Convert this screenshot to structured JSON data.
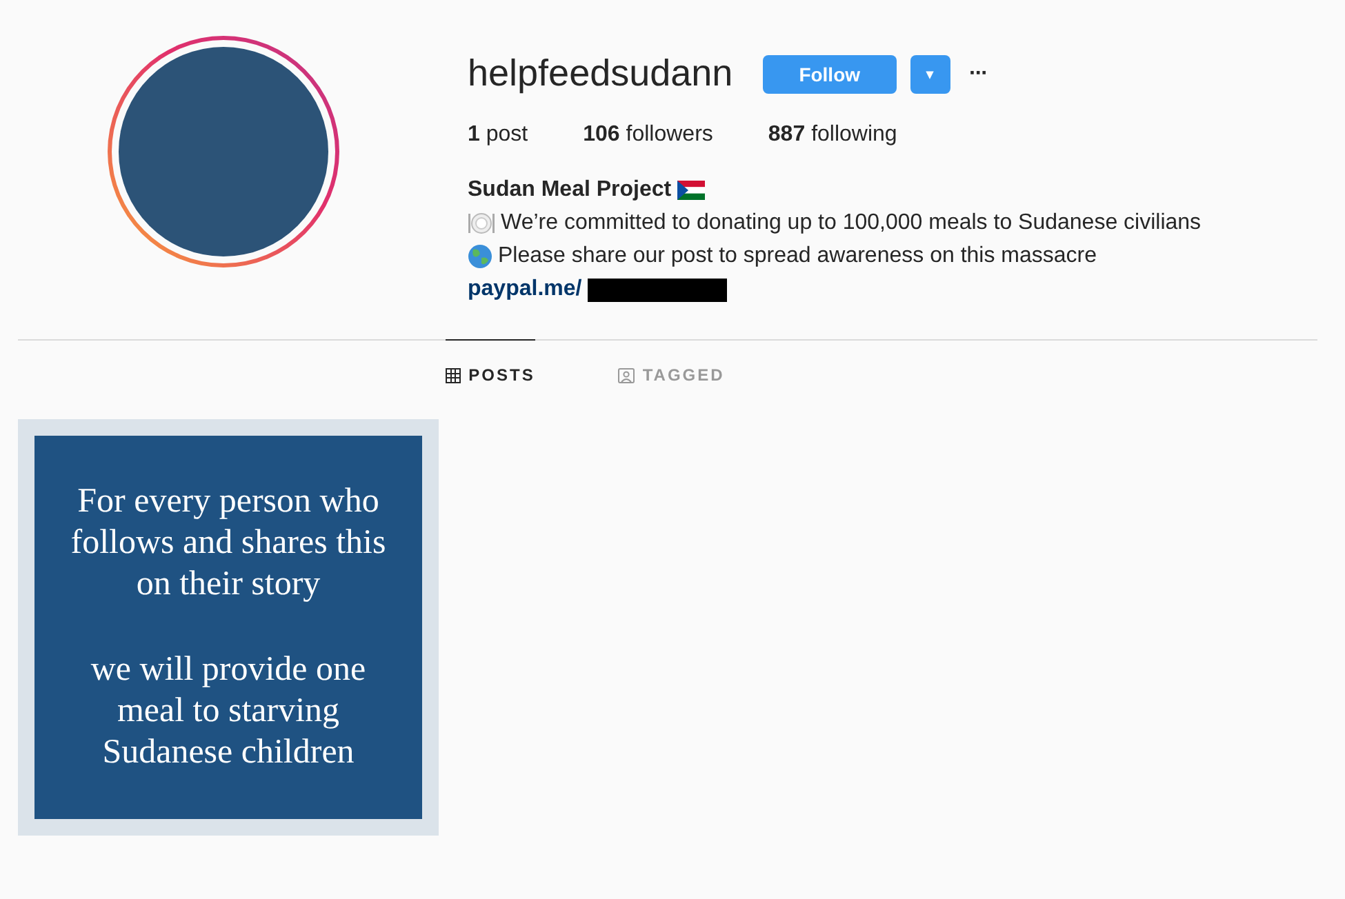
{
  "profile": {
    "username": "helpfeedsudann",
    "follow_button": "Follow",
    "dropdown_button": "▾",
    "more_button": "···"
  },
  "stats": [
    {
      "count": "1",
      "label": "post"
    },
    {
      "count": "106",
      "label": "followers"
    },
    {
      "count": "887",
      "label": "following"
    }
  ],
  "bio": {
    "name": "Sudan Meal Project",
    "lines": [
      {
        "kind": "plate",
        "text": "We’re committed to donating up to 100,000 meals to Sudanese civilians"
      },
      {
        "kind": "globe",
        "text": "Please share our post to spread awareness on this massacre"
      }
    ],
    "link": "paypal.me/"
  },
  "tabs": [
    {
      "label": "POSTS",
      "kind": "grid",
      "selected": true
    },
    {
      "label": "TAGGED",
      "kind": "tag",
      "selected": false
    }
  ],
  "posts": [
    {
      "kind": "quote",
      "paragraphs": [
        "For every person who follows and shares this on their story",
        "we will provide one meal to starving Sudanese children"
      ]
    }
  ]
}
